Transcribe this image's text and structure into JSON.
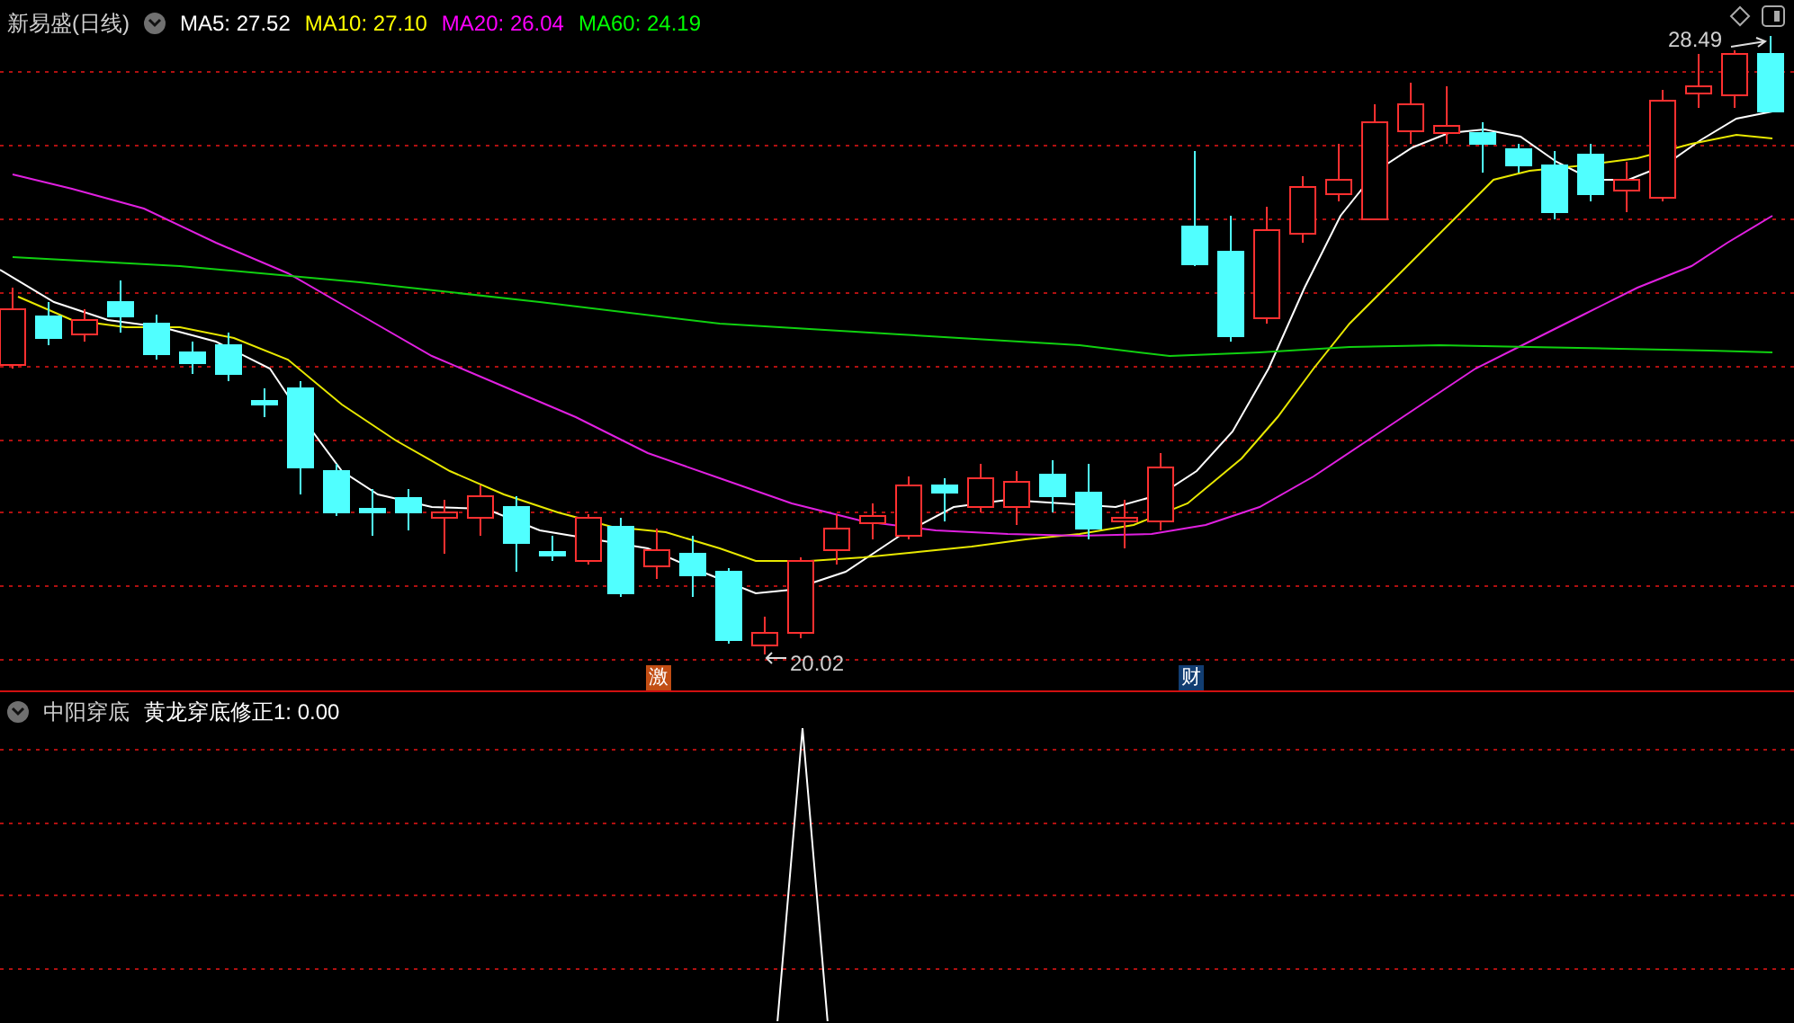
{
  "stock": {
    "name": "新易盛(日线)"
  },
  "moving_averages": [
    {
      "label": "MA5: 27.52",
      "color": "#ffffff"
    },
    {
      "label": "MA10: 27.10",
      "color": "#ffff00"
    },
    {
      "label": "MA20: 26.04",
      "color": "#ff00ff"
    },
    {
      "label": "MA60: 24.19",
      "color": "#00ff00"
    }
  ],
  "price_labels": [
    {
      "kind": "high",
      "text": "28.49"
    },
    {
      "kind": "low",
      "text": "20.02"
    }
  ],
  "markers": [
    {
      "text": "激",
      "color": "#c24e14"
    },
    {
      "text": "财",
      "color": "#123e72"
    }
  ],
  "indicator": {
    "name": "中阳穿底",
    "reading": "黄龙穿底修正1: 0.00"
  }
}
